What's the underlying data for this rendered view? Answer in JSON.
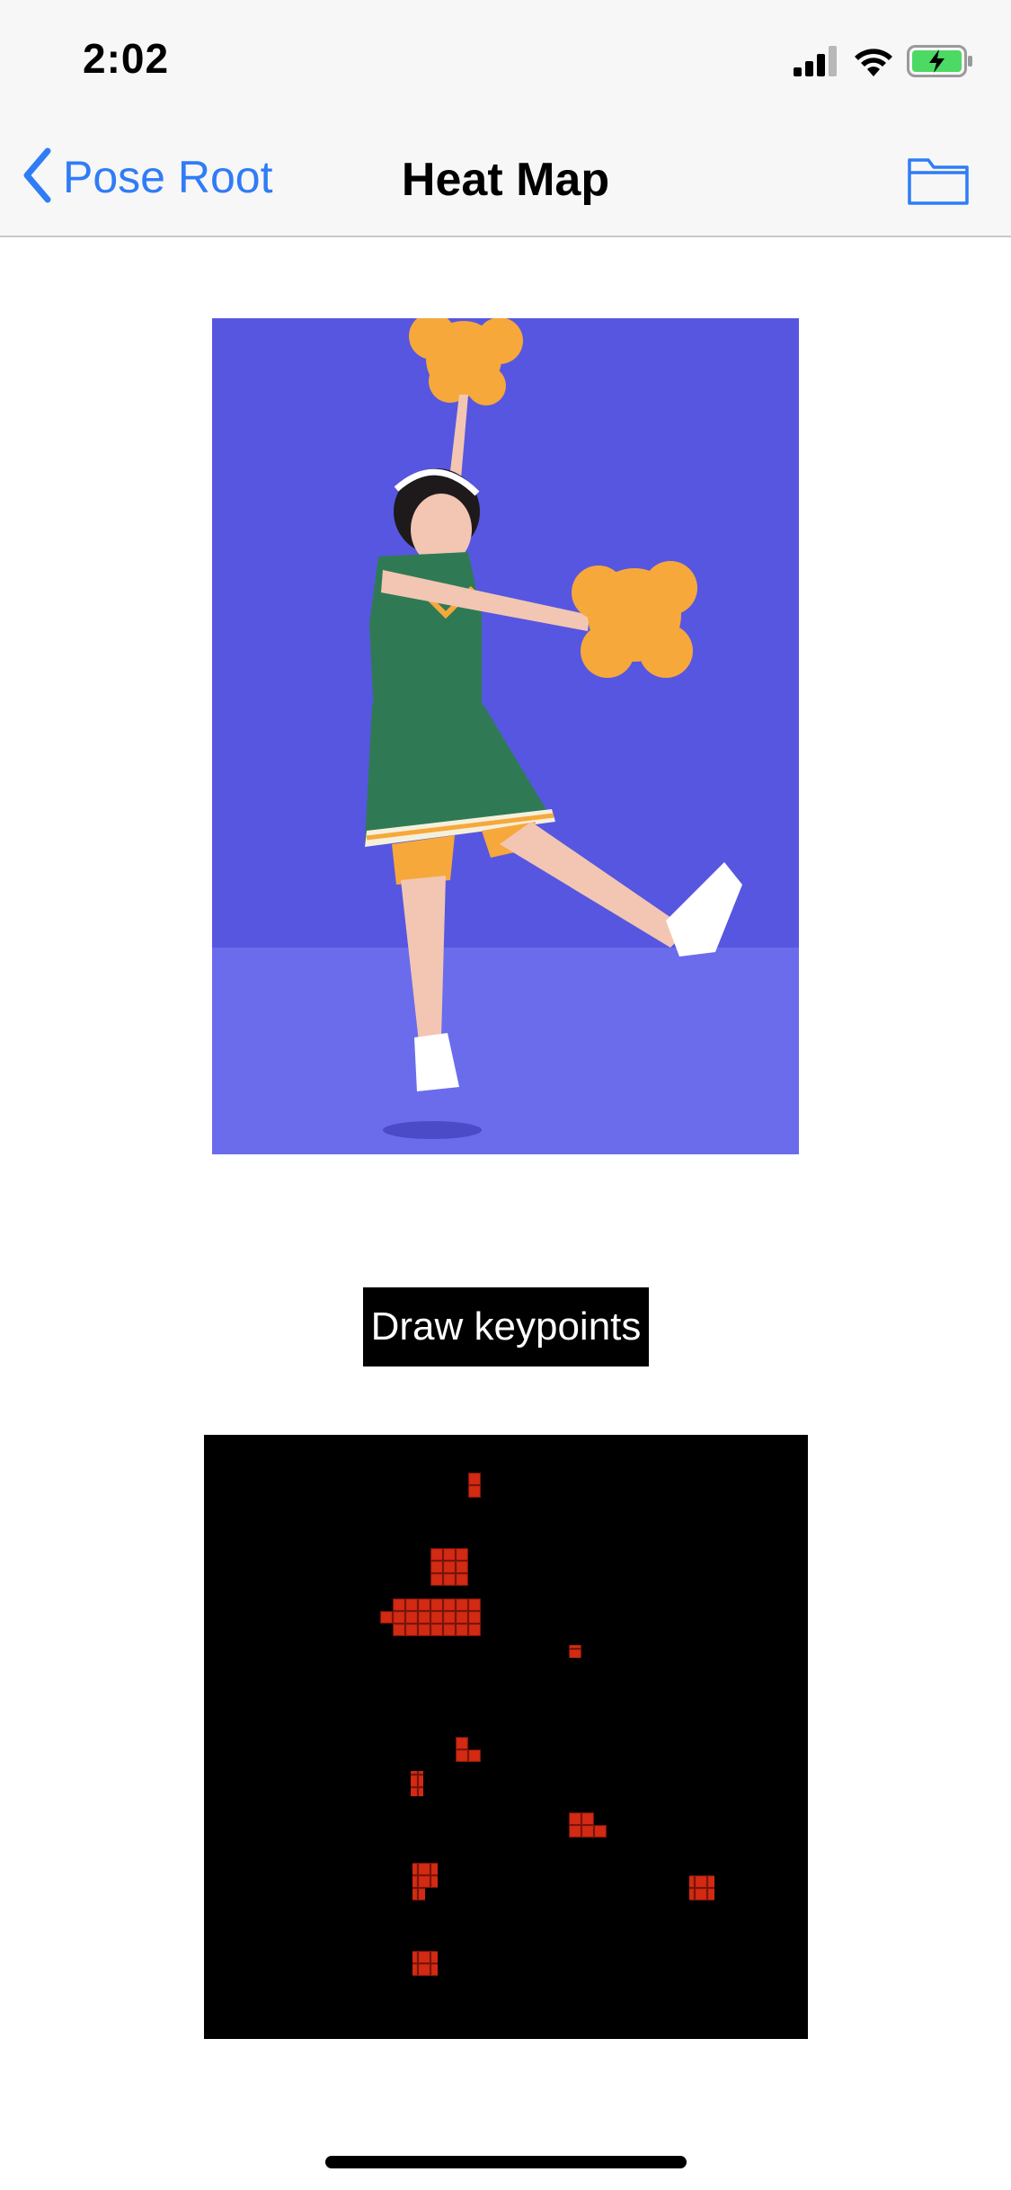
{
  "status_bar": {
    "time": "2:02",
    "icons": [
      "cellular-signal-icon",
      "wifi-icon",
      "battery-charging-icon"
    ],
    "battery_color": "#4cd964"
  },
  "nav": {
    "back_label": "Pose Root",
    "title": "Heat Map",
    "right_icon": "folder-icon",
    "tint_color": "#2f7cf6"
  },
  "photo": {
    "icon": "cheerleader-photo",
    "background_color": "#5756e0"
  },
  "action": {
    "draw_label": "Draw keypoints"
  },
  "heatmap": {
    "grid_size": 14,
    "cell_color": "#d32a14",
    "background_color": "#000000"
  }
}
